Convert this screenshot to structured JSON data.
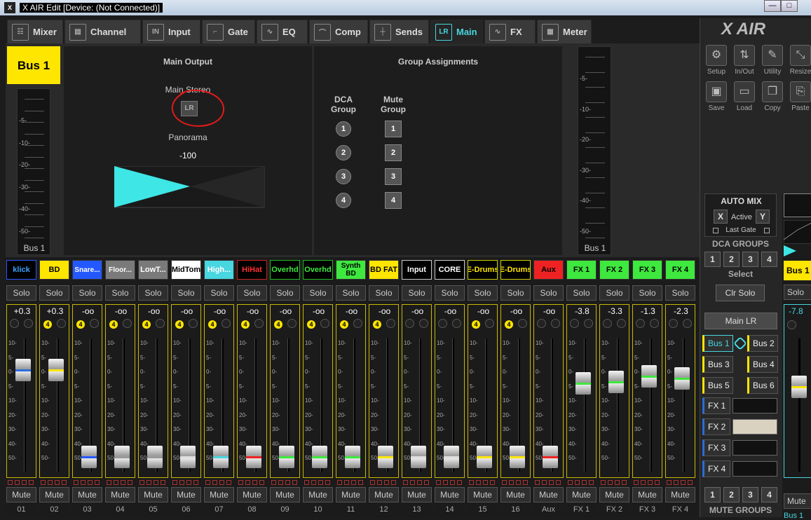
{
  "window": {
    "title": "X AIR Edit [Device: (Not Connected)]",
    "icon": "X",
    "minimize": "—",
    "maximize": "□"
  },
  "tabs": [
    {
      "label": "Mixer",
      "icon": "mixer-icon",
      "glyph": "☷"
    },
    {
      "label": "Channel",
      "icon": "channel-icon",
      "glyph": "▤"
    },
    {
      "label": "Input",
      "icon": "input-icon",
      "glyph": "IN"
    },
    {
      "label": "Gate",
      "icon": "gate-icon",
      "glyph": "⌐"
    },
    {
      "label": "EQ",
      "icon": "eq-icon",
      "glyph": "∿"
    },
    {
      "label": "Comp",
      "icon": "comp-icon",
      "glyph": "⌒"
    },
    {
      "label": "Sends",
      "icon": "sends-icon",
      "glyph": "┼"
    },
    {
      "label": "Main",
      "icon": "main-icon",
      "glyph": "LR"
    },
    {
      "label": "FX",
      "icon": "fx-icon",
      "glyph": "∿"
    },
    {
      "label": "Meter",
      "icon": "meter-icon",
      "glyph": "▦"
    }
  ],
  "active_tab": "Main",
  "bus_header": {
    "label": "Bus 1",
    "meter_label": "Bus 1",
    "color": "#ffe600"
  },
  "meter_scale": [
    "-5-",
    "-10-",
    "-20-",
    "-30-",
    "-40-",
    "-50-"
  ],
  "main_output": {
    "title": "Main Output",
    "stereo_label": "Main Stereo",
    "lr_button": "LR",
    "panorama_label": "Panorama",
    "panorama_value": "-100"
  },
  "group_assignments": {
    "title": "Group Assignments",
    "dca_header": [
      "DCA",
      "Group"
    ],
    "mute_header": [
      "Mute",
      "Group"
    ],
    "dca": [
      "1",
      "2",
      "3",
      "4"
    ],
    "mute": [
      "1",
      "2",
      "3",
      "4"
    ]
  },
  "right_meter_label": "Bus 1",
  "fader_scale": [
    "10-",
    "5-",
    "0-",
    "5-",
    "10-",
    "20-",
    "30-",
    "40-",
    "50-"
  ],
  "strip_common": {
    "solo": "Solo",
    "mute": "Mute"
  },
  "channels": [
    {
      "name": "klick",
      "bg": "#000",
      "fg": "#39a0ff",
      "border": "#2a58ff",
      "value": "+0.3",
      "dca": "",
      "pos": 0.19,
      "stripe": "#2a6be0",
      "num": "01"
    },
    {
      "name": "BD",
      "bg": "#ffe600",
      "fg": "#000",
      "border": "#333",
      "value": "+0.3",
      "dca": "4",
      "pos": 0.19,
      "stripe": "#ffe600",
      "num": "02"
    },
    {
      "name": "Snare...",
      "bg": "#2458ff",
      "fg": "#fff",
      "border": "#333",
      "value": "-oo",
      "dca": "4",
      "pos": 0.92,
      "stripe": "#2458ff",
      "num": "03"
    },
    {
      "name": "Floor...",
      "bg": "#7a7a7a",
      "fg": "#fff",
      "border": "#333",
      "value": "-oo",
      "dca": "4",
      "pos": 0.92,
      "stripe": "#999",
      "num": "04"
    },
    {
      "name": "LowT...",
      "bg": "#7a7a7a",
      "fg": "#fff",
      "border": "#333",
      "value": "-oo",
      "dca": "4",
      "pos": 0.92,
      "stripe": "#999",
      "num": "05"
    },
    {
      "name": "MidTom",
      "bg": "#fff",
      "fg": "#000",
      "border": "#333",
      "value": "-oo",
      "dca": "4",
      "pos": 0.92,
      "stripe": "#ddd",
      "num": "06"
    },
    {
      "name": "High...",
      "bg": "#48d6e0",
      "fg": "#fff",
      "border": "#333",
      "value": "-oo",
      "dca": "4",
      "pos": 0.92,
      "stripe": "#48d6e0",
      "num": "07"
    },
    {
      "name": "HiHat",
      "bg": "#000",
      "fg": "#ff3030",
      "border": "#c22",
      "value": "-oo",
      "dca": "4",
      "pos": 0.92,
      "stripe": "#e22",
      "num": "08"
    },
    {
      "name": "Overhd",
      "bg": "#000",
      "fg": "#3ee83e",
      "border": "#2b2",
      "value": "-oo",
      "dca": "4",
      "pos": 0.92,
      "stripe": "#3ee83e",
      "num": "09"
    },
    {
      "name": "Overhd",
      "bg": "#000",
      "fg": "#3ee83e",
      "border": "#2b2",
      "value": "-oo",
      "dca": "4",
      "pos": 0.92,
      "stripe": "#3ee83e",
      "num": "10"
    },
    {
      "name": "Synth BD",
      "bg": "#3ee83e",
      "fg": "#000",
      "border": "#333",
      "value": "-oo",
      "dca": "4",
      "pos": 0.92,
      "stripe": "#3ee83e",
      "num": "11"
    },
    {
      "name": "BD FAT",
      "bg": "#ffe600",
      "fg": "#000",
      "border": "#333",
      "value": "-oo",
      "dca": "4",
      "pos": 0.92,
      "stripe": "#ffe600",
      "num": "12"
    },
    {
      "name": "Input",
      "bg": "#000",
      "fg": "#fff",
      "border": "#ccc",
      "value": "-oo",
      "dca": "",
      "pos": 0.92,
      "stripe": "#ddd",
      "num": "13"
    },
    {
      "name": "CORE",
      "bg": "#000",
      "fg": "#fff",
      "border": "#ccc",
      "value": "-oo",
      "dca": "",
      "pos": 0.92,
      "stripe": "#ddd",
      "num": "14"
    },
    {
      "name": "E-Drums",
      "bg": "#000",
      "fg": "#ffe600",
      "border": "#cc0",
      "value": "-oo",
      "dca": "4",
      "pos": 0.92,
      "stripe": "#ffe600",
      "num": "15"
    },
    {
      "name": "E-Drums",
      "bg": "#000",
      "fg": "#ffe600",
      "border": "#cc0",
      "value": "-oo",
      "dca": "4",
      "pos": 0.92,
      "stripe": "#ffe600",
      "num": "16"
    },
    {
      "name": "Aux",
      "bg": "#e22",
      "fg": "#000",
      "border": "#333",
      "value": "-oo",
      "dca": "",
      "pos": 0.92,
      "stripe": "#e22",
      "num": "Aux"
    },
    {
      "name": "FX 1",
      "bg": "#3ee83e",
      "fg": "#000",
      "border": "#333",
      "value": "-3.8",
      "dca": "",
      "pos": 0.3,
      "stripe": "#3ee83e",
      "num": "FX 1"
    },
    {
      "name": "FX 2",
      "bg": "#3ee83e",
      "fg": "#000",
      "border": "#333",
      "value": "-3.3",
      "dca": "",
      "pos": 0.29,
      "stripe": "#3ee83e",
      "num": "FX 2"
    },
    {
      "name": "FX 3",
      "bg": "#3ee83e",
      "fg": "#000",
      "border": "#333",
      "value": "-1.3",
      "dca": "",
      "pos": 0.24,
      "stripe": "#3ee83e",
      "num": "FX 3"
    },
    {
      "name": "FX 4",
      "bg": "#3ee83e",
      "fg": "#000",
      "border": "#333",
      "value": "-2.3",
      "dca": "",
      "pos": 0.26,
      "stripe": "#3ee83e",
      "num": "FX 4"
    }
  ],
  "logo": "X AIR",
  "toolbar": [
    {
      "label": "Setup",
      "icon": "gear-icon",
      "glyph": "⚙"
    },
    {
      "label": "In/Out",
      "icon": "in-out-icon",
      "glyph": "⇅"
    },
    {
      "label": "Utility",
      "icon": "wrench-icon",
      "glyph": "✎"
    },
    {
      "label": "Resize",
      "icon": "resize-icon",
      "glyph": "⤡"
    },
    {
      "label": "Save",
      "icon": "save-icon",
      "glyph": "▣"
    },
    {
      "label": "Load",
      "icon": "folder-icon",
      "glyph": "▭"
    },
    {
      "label": "Copy",
      "icon": "copy-icon",
      "glyph": "❐"
    },
    {
      "label": "Paste",
      "icon": "paste-icon",
      "glyph": "⎘"
    }
  ],
  "automix": {
    "title": "AUTO MIX",
    "x": "X",
    "active": "Active",
    "y": "Y",
    "last_gate": "Last Gate"
  },
  "dca_groups": {
    "title": "DCA GROUPS",
    "items": [
      "1",
      "2",
      "3",
      "4"
    ]
  },
  "select": {
    "label": "Select",
    "clr_solo": "Clr Solo",
    "main_lr": "Main LR"
  },
  "buses": [
    "Bus 1",
    "Bus 2",
    "Bus 3",
    "Bus 4",
    "Bus 5",
    "Bus 6"
  ],
  "fx_buttons": [
    "FX 1",
    "FX 2",
    "FX 3",
    "FX 4"
  ],
  "mute_groups": {
    "title": "MUTE GROUPS",
    "items": [
      "1",
      "2",
      "3",
      "4"
    ]
  },
  "bus_strip": {
    "name": "Bus 1",
    "solo": "Solo",
    "value": "-7.8",
    "pos": 0.33,
    "mute": "Mute",
    "num": "Bus 1"
  }
}
